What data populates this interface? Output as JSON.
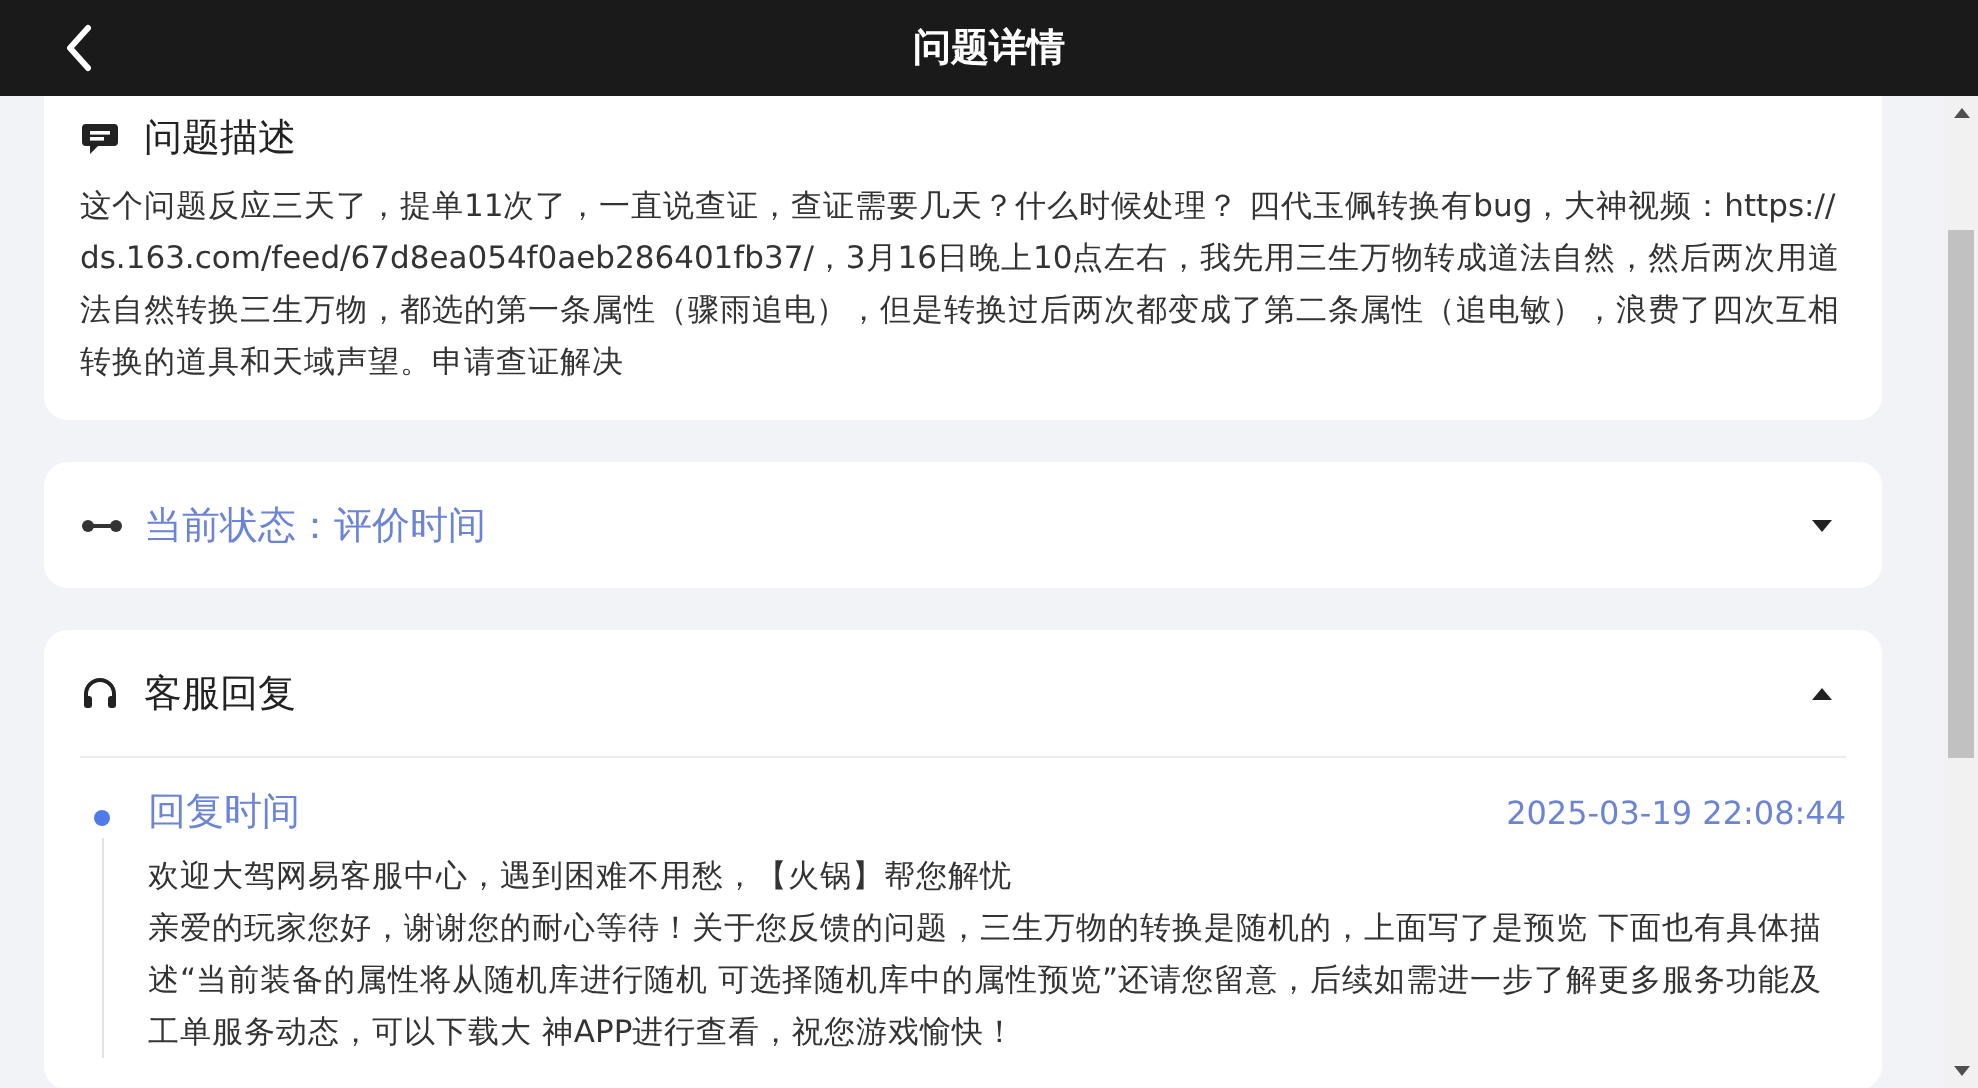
{
  "header": {
    "title": "问题详情"
  },
  "description": {
    "title": "问题描述",
    "text": "这个问题反应三天了，提单11次了，一直说查证，查证需要几天？什么时候处理？ 四代玉佩转换有bug，大神视频：https://ds.163.com/feed/67d8ea054f0aeb286401fb37/，3月16日晚上10点左右，我先用三生万物转成道法自然，然后两次用道法自然转换三生万物，都选的第一条属性（骤雨追电），但是转换过后两次都变成了第二条属性（追电敏），浪费了四次互相转换的道具和天域声望。申请查证解决"
  },
  "status": {
    "label": "当前状态：评价时间",
    "expanded": false
  },
  "reply": {
    "title": "客服回复",
    "expanded": true,
    "entries": [
      {
        "label": "回复时间",
        "time": "2025-03-19 22:08:44",
        "paragraphs": [
          "欢迎大驾网易客服中心，遇到困难不用愁，【火锅】帮您解忧",
          "亲爱的玩家您好，谢谢您的耐心等待！关于您反馈的问题，三生万物的转换是随机的，上面写了是预览 下面也有具体描述“当前装备的属性将从随机库进行随机 可选择随机库中的属性预览”还请您留意，后续如需进一步了解更多服务功能及工单服务动态，可以下载大 神APP进行查看，祝您游戏愉快！"
        ]
      }
    ]
  }
}
